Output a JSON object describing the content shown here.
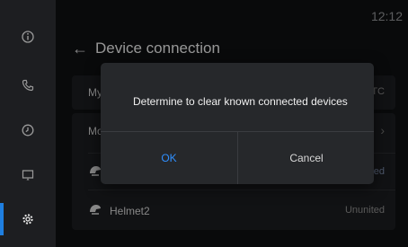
{
  "clock": "12:12",
  "sidebar": {
    "items": [
      {
        "icon": "info-icon"
      },
      {
        "icon": "phone-icon"
      },
      {
        "icon": "clock-icon"
      },
      {
        "icon": "screen-icon"
      },
      {
        "icon": "settings-icon",
        "active": true
      }
    ]
  },
  "header": {
    "title": "Device connection"
  },
  "list": {
    "row1": {
      "name": "My",
      "right": "BTC"
    },
    "row2": {
      "name": "Mo"
    },
    "row3": {
      "status": "ded"
    },
    "row4": {
      "name": "Helmet2",
      "status": "Ununited"
    }
  },
  "dialog": {
    "message": "Determine to clear known connected devices",
    "ok_label": "OK",
    "cancel_label": "Cancel"
  },
  "colors": {
    "accent": "#1f7fe0",
    "ok": "#2f8fff"
  }
}
